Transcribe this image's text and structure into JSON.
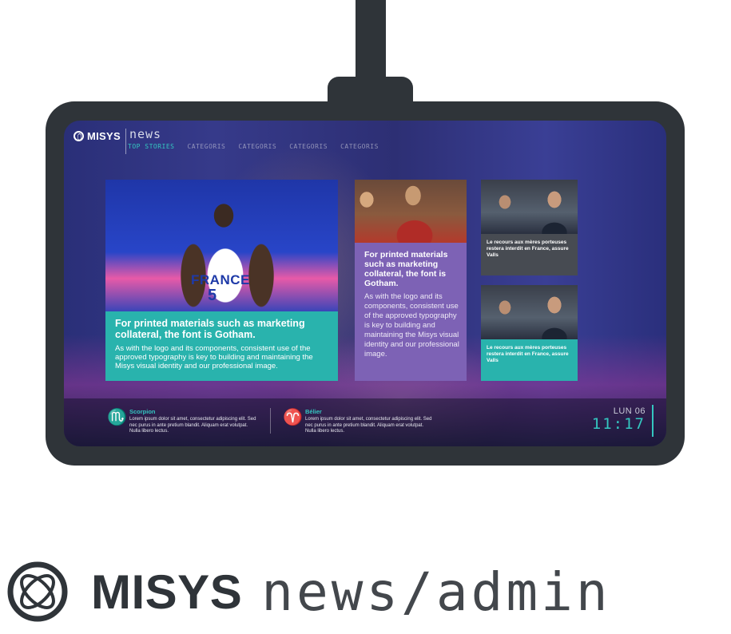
{
  "header": {
    "brand": "MISYS",
    "product": "news",
    "tabs": [
      "TOP STORIES",
      "CATEGORIS",
      "CATEGORIS",
      "CATEGORIS",
      "CATEGORIS"
    ]
  },
  "main_card": {
    "photo_jersey": "FRANCE",
    "photo_number": "5",
    "headline": "For printed materials such as marketing collateral, the font is Gotham.",
    "body": "As with the logo and its components, consistent use of the approved typography is key to building and maintaining the Misys visual identity and our professional image."
  },
  "mid_card": {
    "headline": "For printed materials such as marketing collateral, the font is Gotham.",
    "body": "As with the logo and its components, consistent use of the approved typography is key to building and maintaining the Misys visual identity and our professional image."
  },
  "small_cards": [
    {
      "caption": "Le recours aux mères porteuses restera interdit en France, assure Valls"
    },
    {
      "caption": "Le recours aux mères porteuses restera interdit en France, assure Valls"
    }
  ],
  "horoscope": [
    {
      "icon": "scorpio-icon",
      "sign": "Scorpion",
      "text": "Lorem ipsum dolor sit amet, consectetur adipiscing elit. Sed nec purus in ante pretium blandit. Aliquam erat volutpat. Nulla libero lectus."
    },
    {
      "icon": "aries-icon",
      "sign": "Bélier",
      "text": "Lorem ipsum dolor sit amet, consectetur adipiscing elit. Sed nec purus in ante pretium blandit. Aliquam erat volutpat. Nulla libero lectus."
    }
  ],
  "clock": {
    "day": "LUN 06",
    "time": "11:17"
  },
  "footer_brand": {
    "name": "MISYS",
    "suffix": "news/admin"
  },
  "colors": {
    "teal": "#29b3ad",
    "purple": "#7d62b5",
    "dark": "#2f3439",
    "accent": "#34c6c0"
  }
}
